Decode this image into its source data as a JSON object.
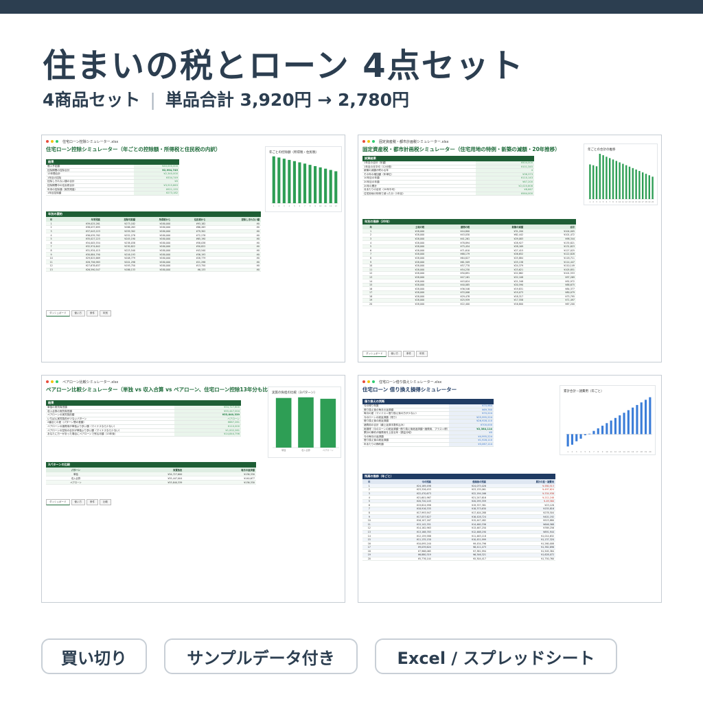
{
  "header": {
    "title": "住まいの税とローン 4点セット",
    "subtitle_count": "4商品セット",
    "subtitle_separator": "|",
    "subtitle_price": "単品合計 3,920円 → 2,780円"
  },
  "badges": [
    "買い切り",
    "サンプルデータ付き",
    "Excel / スプレッドシート"
  ],
  "colors": {
    "green": "#2e9e55",
    "navy": "#2c3e50",
    "blue": "#3b7dd8",
    "dark_green": "#1e5e35"
  },
  "panels": [
    {
      "filename": "住宅ローン控除シミュレーター.xlsx",
      "title": "住宅ローン控除シミュレーター（年ごとの控除額・所得税と住民税の内訳）",
      "summary_header": "結果",
      "summary": [
        {
          "k": "借入予定額",
          "v": "¥40,000,000"
        },
        {
          "k": "控除期間の控除合計",
          "v": "¥2,994,749"
        },
        {
          "k": "13年間合計",
          "v": "¥2,340,000"
        },
        {
          "k": "1年目の控除",
          "v": "¥334,749"
        },
        {
          "k": "控除しきれない額の合計",
          "v": "¥0"
        },
        {
          "k": "控除期間中の住民税合計",
          "v": "¥3,915,863"
        },
        {
          "k": "年末の控除額（実質残高）",
          "v": "¥921,155"
        },
        {
          "k": "1年目控除額",
          "v": "¥273,182"
        }
      ],
      "table_header": "年別の要約",
      "table_columns": [
        "年",
        "年末残高",
        "控除可能額",
        "所得税から",
        "住民税から",
        "控除しきれない額"
      ],
      "table_rows": [
        [
          "1",
          "¥39,025,261",
          "¥273,182",
          "¥180,000",
          "¥93,182",
          "¥0"
        ],
        [
          "2",
          "¥38,037,695",
          "¥266,263",
          "¥180,000",
          "¥86,263",
          "¥0"
        ],
        [
          "3",
          "¥37,043,223",
          "¥259,302",
          "¥180,000",
          "¥79,302",
          "¥0"
        ],
        [
          "4",
          "¥36,039,762",
          "¥252,278",
          "¥180,000",
          "¥72,278",
          "¥0"
        ],
        [
          "5",
          "¥35,027,223",
          "¥245,190",
          "¥180,000",
          "¥65,190",
          "¥0"
        ],
        [
          "6",
          "¥34,005,554",
          "¥238,038",
          "¥180,000",
          "¥58,038",
          "¥0"
        ],
        [
          "7",
          "¥32,974,642",
          "¥230,822",
          "¥180,000",
          "¥50,822",
          "¥0"
        ],
        [
          "8",
          "¥31,934,415",
          "¥223,540",
          "¥180,000",
          "¥43,540",
          "¥0"
        ],
        [
          "9",
          "¥30,884,790",
          "¥216,193",
          "¥180,000",
          "¥36,193",
          "¥0"
        ],
        [
          "10",
          "¥29,825,669",
          "¥208,779",
          "¥180,000",
          "¥28,779",
          "¥0"
        ],
        [
          "11",
          "¥28,756,983",
          "¥201,298",
          "¥180,000",
          "¥21,298",
          "¥0"
        ],
        [
          "12",
          "¥27,678,637",
          "¥193,750",
          "¥180,000",
          "¥13,750",
          "¥0"
        ],
        [
          "13",
          "¥26,590,547",
          "¥186,133",
          "¥180,000",
          "¥6,133",
          "¥0"
        ]
      ],
      "tabs": [
        "ダッシュボード",
        "使い方",
        "条件",
        "年別"
      ],
      "chart_title": "年ごとの控除額（所得税・住民税）"
    },
    {
      "filename": "固定資産税・都市計画税シミュレーター.xlsx",
      "title": "固定資産税・都市計画税シミュレーター（住宅用地の特例・新築の減額・20年推移）",
      "summary_header": "試算結果",
      "summary": [
        {
          "k": "1年目の合計（年額）",
          "v": "¥504,000"
        },
        {
          "k": "1年目の月平均（12分割）",
          "v": "¥101,345"
        },
        {
          "k": "新築の減額が終わる年",
          "v": "4"
        },
        {
          "k": "その年の増加額（年単位）",
          "v": "¥36,373"
        },
        {
          "k": "10年目の年額",
          "v": "¥110,143"
        },
        {
          "k": "20年目の年額",
          "v": "¥67,200"
        },
        {
          "k": "20年の累計",
          "v": "¥2,020,808"
        },
        {
          "k": "月あたりの目安（20年平均）",
          "v": "¥8,667"
        },
        {
          "k": "住宅用地の特例で減った分（1年目）",
          "v": "¥564,000"
        }
      ],
      "table_header": "年別の推移（20年）",
      "table_columns": [
        "年",
        "土地の税",
        "建物の税",
        "新築の減額",
        "合計"
      ],
      "table_rows": [
        [
          "1",
          "¥28,000",
          "¥44,800",
          "¥31,200",
          "¥104,005"
        ],
        [
          "2",
          "¥28,000",
          "¥43,030",
          "¥62,442",
          "¥101,472"
        ],
        [
          "3",
          "¥28,000",
          "¥41,261",
          "¥29,083",
          "¥98,344"
        ],
        [
          "4",
          "¥28,000",
          "¥78,894",
          "¥28,927",
          "¥135,821"
        ],
        [
          "5",
          "¥28,000",
          "¥75,454",
          "¥28,169",
          "¥131,623"
        ],
        [
          "6",
          "¥28,000",
          "¥71,610",
          "¥27,415",
          "¥127,025"
        ],
        [
          "7",
          "¥28,000",
          "¥68,179",
          "¥26,652",
          "¥122,828"
        ],
        [
          "8",
          "¥28,000",
          "¥64,827",
          "¥25,884",
          "¥118,711"
        ],
        [
          "9",
          "¥28,000",
          "¥61,509",
          "¥25,138",
          "¥114,447"
        ],
        [
          "10",
          "¥28,000",
          "¥57,770",
          "¥24,379",
          "¥110,149"
        ],
        [
          "11",
          "¥28,000",
          "¥54,230",
          "¥23,621",
          "¥105,851"
        ],
        [
          "12",
          "¥28,000",
          "¥50,691",
          "¥22,862",
          "¥101,553"
        ],
        [
          "13",
          "¥28,000",
          "¥47,161",
          "¥22,108",
          "¥97,269"
        ],
        [
          "14",
          "¥28,000",
          "¥43,624",
          "¥21,348",
          "¥92,972"
        ],
        [
          "15",
          "¥28,000",
          "¥40,085",
          "¥20,590",
          "¥88,675"
        ],
        [
          "16",
          "¥28,000",
          "¥36,546",
          "¥19,831",
          "¥84,377"
        ],
        [
          "17",
          "¥28,000",
          "¥33,006",
          "¥19,073",
          "¥80,079"
        ],
        [
          "18",
          "¥28,000",
          "¥29,478",
          "¥18,317",
          "¥75,795"
        ],
        [
          "19",
          "¥28,000",
          "¥25,939",
          "¥17,558",
          "¥71,497"
        ],
        [
          "20",
          "¥28,000",
          "¥22,400",
          "¥16,800",
          "¥67,200"
        ]
      ],
      "tabs": [
        "ダッシュボード",
        "使い方",
        "条件",
        "年別"
      ],
      "chart_title": "年ごとの合計の推移"
    },
    {
      "filename": "ペアローン比較シミュレーター.xlsx",
      "title": "ペアローン比較シミュレーター（単独 vs 収入合算 vs ペアローン、住宅ローン控除13年分も比較）",
      "summary_header": "結果",
      "summary": [
        {
          "k": "単独の実質負担額",
          "v": "¥54,727,600"
        },
        {
          "k": "収入合算の実質負担額",
          "v": "¥55,447,004"
        },
        {
          "k": "ペアローンの実質負担額",
          "v": "¥53,840,339"
        },
        {
          "k": "いちばん実質負担が少ないパターン",
          "v": "ペアローン"
        },
        {
          "k": "2番目との差（パターン間の差額）",
          "v": "¥887,261"
        },
        {
          "k": "ペアローンの諸費用が単独より多い額（マイナスなら少ない）",
          "v": "¥110,000"
        },
        {
          "k": "ペアローンの控除の合計が単独より多い額（マイナスなら少ない）",
          "v": "¥1,002,261"
        },
        {
          "k": "あなたに万一があった場合にペアローンで残る月額（13年後）",
          "v": "¥14,844,796"
        }
      ],
      "table_header": "3パターンの比較",
      "table_columns": [
        "パターン",
        "実質負担",
        "毎月の返済額"
      ],
      "table_rows": [
        [
          "単独",
          "¥54,727,600",
          "¥136,330"
        ],
        [
          "収入合算",
          "¥55,447,004",
          "¥140,677"
        ],
        [
          "ペアローン",
          "¥53,840,339",
          "¥136,330"
        ]
      ],
      "tabs": [
        "ダッシュボード",
        "使い方",
        "条件",
        "比較"
      ],
      "chart_title": "実質の負担の比較（3パターン）",
      "chart_labels": [
        "単独",
        "収入合算",
        "ペアローン"
      ]
    },
    {
      "filename": "住宅ローン借り換えシミュレーター.xlsx",
      "title": "住宅ローン 借り換え損得シミュレーター",
      "summary_header": "借り換えの判断",
      "summary": [
        {
          "k": "今の残り年数",
          "v": "¥70,984"
        },
        {
          "k": "借り換え後の毎月の返済額",
          "v": "¥69,760"
        },
        {
          "k": "毎月の差（マイナス＝借り換え後の方が少ない）",
          "v": "¥70,224"
        },
        {
          "k": "今のローンの総返済額（残り）",
          "v": "¥25,995,224"
        },
        {
          "k": "借り換え後の総返済額",
          "v": "¥26,928,110"
        },
        {
          "k": "諸費用の合計（繰上返済手数料込み）",
          "v": "¥700,000"
        },
        {
          "k": "総損得（今のローンの総返済額−借り換え後総返済額−諸費用、プラス＝得）",
          "v": "¥2,384,114"
        },
        {
          "k": "累計の節約が諸費用を上回る年（損益分岐）",
          "v": "¥0"
        },
        {
          "k": "今の毎月の返済額",
          "v": "¥4,995,224"
        },
        {
          "k": "借り換え後の総返済額",
          "v": "¥1,928,110"
        },
        {
          "k": "年あたりの節約額",
          "v": "¥3,067,114"
        }
      ],
      "table_header": "残高の推移（年ごと）",
      "table_columns": [
        "年",
        "今の残高",
        "借換後の残高",
        "累計の差－諸費用"
      ],
      "table_rows": [
        [
          "1",
          "¥24,169,498",
          "¥24,075,026",
          "¥-580,513"
        ],
        [
          "2",
          "¥23,326,453",
          "¥23,135,061",
          "¥-497,624"
        ],
        [
          "3",
          "¥22,470,673",
          "¥22,194,166",
          "¥-334,936"
        ],
        [
          "4",
          "¥21,601,967",
          "¥21,247,616",
          "¥-212,248"
        ],
        [
          "5",
          "¥20,720,145",
          "¥20,295,359",
          "¥-49,560"
        ],
        [
          "6",
          "¥19,824,998",
          "¥19,337,381",
          "¥23,128"
        ],
        [
          "7",
          "¥18,916,335",
          "¥18,373,630",
          "¥155,816"
        ],
        [
          "8",
          "¥17,993,947",
          "¥17,404,288",
          "¥278,504"
        ],
        [
          "9",
          "¥17,057,627",
          "¥16,428,724",
          "¥401,192"
        ],
        [
          "10",
          "¥16,107,167",
          "¥15,447,482",
          "¥523,880"
        ],
        [
          "11",
          "¥15,142,351",
          "¥14,460,336",
          "¥646,568"
        ],
        [
          "12",
          "¥14,162,963",
          "¥13,467,250",
          "¥769,256"
        ],
        [
          "13",
          "¥13,168,783",
          "¥12,468,190",
          "¥891,944"
        ],
        [
          "14",
          "¥12,159,588",
          "¥11,463,118",
          "¥1,014,632"
        ],
        [
          "15",
          "¥11,135,150",
          "¥10,451,999",
          "¥1,137,320"
        ],
        [
          "16",
          "¥10,095,240",
          "¥9,434,796",
          "¥1,260,008"
        ],
        [
          "17",
          "¥9,039,624",
          "¥8,411,473",
          "¥1,382,696"
        ],
        [
          "18",
          "¥7,968,065",
          "¥7,381,994",
          "¥1,505,384"
        ],
        [
          "19",
          "¥6,880,319",
          "¥6,346,321",
          "¥1,628,072"
        ],
        [
          "20",
          "¥5,776,144",
          "¥5,304,417",
          "¥1,750,760"
        ]
      ],
      "chart_title": "累計合計－諸費用（年ごと）"
    }
  ],
  "chart_data": [
    {
      "type": "bar",
      "title": "年ごとの控除額（所得税・住民税）",
      "categories": [
        "1",
        "2",
        "3",
        "4",
        "5",
        "6",
        "7",
        "8",
        "9",
        "10",
        "11",
        "12",
        "13"
      ],
      "values": [
        273182,
        266263,
        259302,
        252278,
        245190,
        238038,
        230822,
        223540,
        216193,
        208779,
        201298,
        193750,
        186133
      ],
      "ylim": [
        0,
        280000
      ]
    },
    {
      "type": "bar",
      "title": "年ごとの合計の推移",
      "categories": [
        "1",
        "2",
        "3",
        "4",
        "5",
        "6",
        "7",
        "8",
        "9",
        "10",
        "11",
        "12",
        "13",
        "14",
        "15",
        "16",
        "17",
        "18",
        "19",
        "20"
      ],
      "values": [
        104005,
        101472,
        98344,
        135821,
        131623,
        127025,
        122828,
        118711,
        114447,
        110149,
        105851,
        101553,
        97269,
        92972,
        88675,
        84377,
        80079,
        75795,
        71497,
        67200
      ],
      "ylim": [
        0,
        140000
      ]
    },
    {
      "type": "bar",
      "title": "実質の負担の比較（3パターン）",
      "categories": [
        "単独",
        "収入合算",
        "ペアローン"
      ],
      "values": [
        54727600,
        55447004,
        53840339
      ],
      "ylim": [
        0,
        56000000
      ]
    },
    {
      "type": "bar",
      "title": "累計合計－諸費用（年ごと）",
      "categories": [
        "1",
        "2",
        "3",
        "4",
        "5",
        "6",
        "7",
        "8",
        "9",
        "10",
        "11",
        "12",
        "13",
        "14",
        "15",
        "16",
        "17",
        "18",
        "19",
        "20"
      ],
      "values": [
        -580513,
        -497624,
        -334936,
        -212248,
        -49560,
        23128,
        155816,
        278504,
        401192,
        523880,
        646568,
        769256,
        891944,
        1014632,
        1137320,
        1260008,
        1382696,
        1505384,
        1628072,
        1750760
      ],
      "ylim": [
        -700000,
        1900000
      ]
    }
  ]
}
